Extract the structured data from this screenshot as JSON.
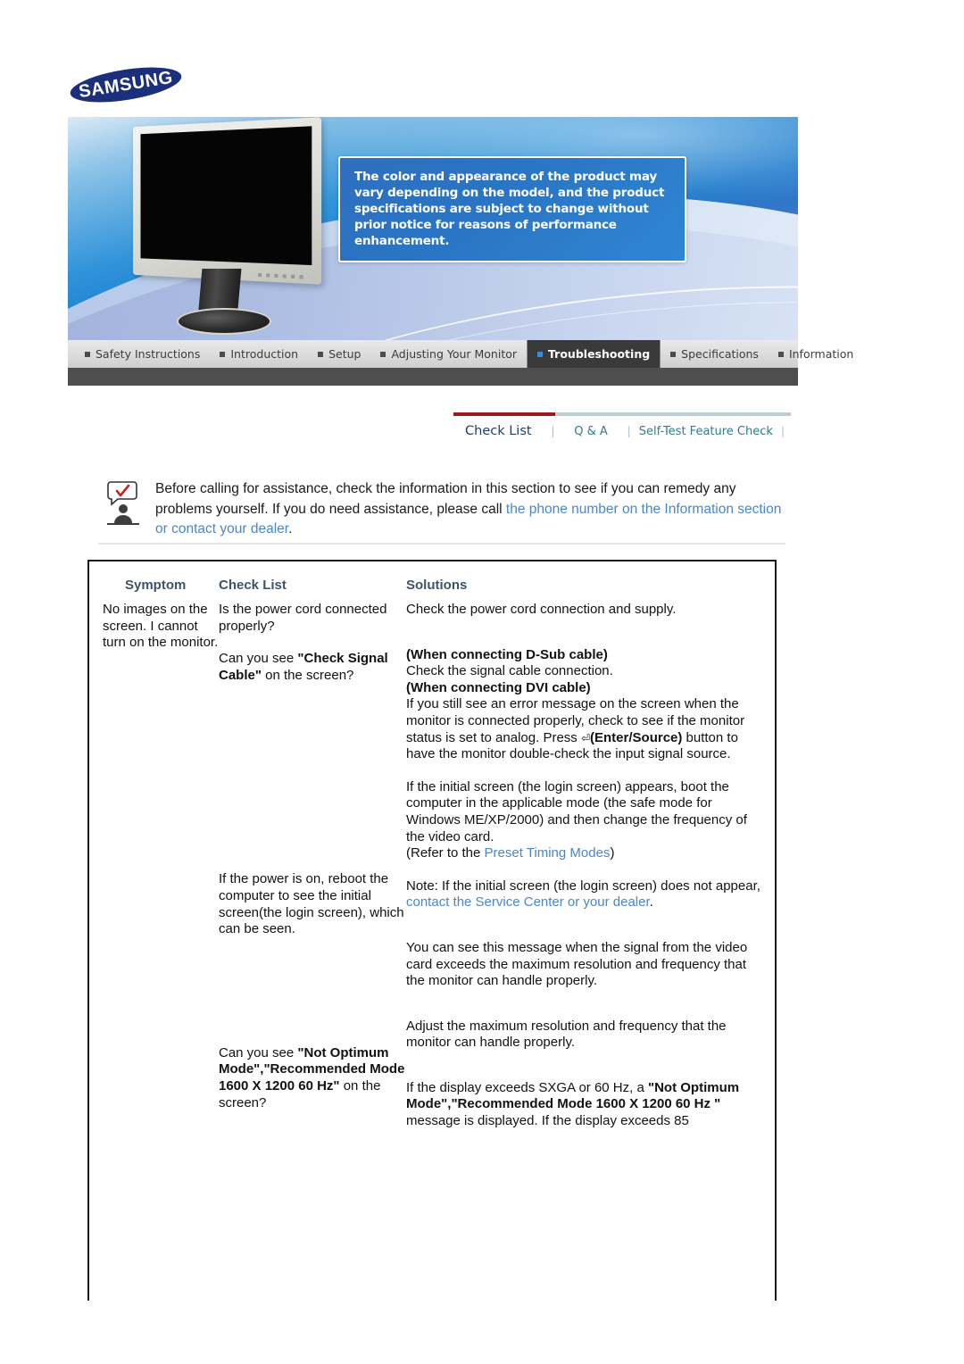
{
  "brand": {
    "logo_text": "SAMSUNG"
  },
  "banner": {
    "disclaimer": "The color and appearance of the product may vary depending on the model, and the product specifications are subject to change without prior notice for reasons of performance enhancement.",
    "product_image_alt": "silver-lcd-monitor"
  },
  "nav": {
    "items": [
      {
        "label": "Safety Instructions",
        "active": false
      },
      {
        "label": "Introduction",
        "active": false
      },
      {
        "label": "Setup",
        "active": false
      },
      {
        "label": "Adjusting Your Monitor",
        "active": false
      },
      {
        "label": "Troubleshooting",
        "active": true
      },
      {
        "label": "Specifications",
        "active": false
      },
      {
        "label": "Information",
        "active": false
      }
    ],
    "active_accent": "#2f8fe0",
    "active_bg": "#3a3a3a"
  },
  "subnav": {
    "items": [
      {
        "label": "Check List",
        "active": true
      },
      {
        "label": "Q & A",
        "active": false
      },
      {
        "label": "Self-Test Feature Check",
        "active": false
      }
    ],
    "separator": "|",
    "accent_red": "#9e1b1b",
    "accent_teal": "#2f7d8c"
  },
  "intro": {
    "icon": "person-with-checkmark-speech-bubble-icon",
    "text_part1": "Before calling for assistance, check the information in this section to see if you can remedy any problems yourself. If you do need assistance, please call ",
    "link_text": "the phone number on the Information section or contact your dealer",
    "text_part2": "."
  },
  "table": {
    "headers": {
      "symptom": "Symptom",
      "check_list": "Check List",
      "solutions": "Solutions"
    },
    "symptom": "No images on the screen. I cannot turn on the monitor.",
    "checklist": {
      "row1": "Is the power cord connected properly?",
      "row2_pre": "Can you see ",
      "row2_bold": "\"Check Signal Cable\"",
      "row2_post": " on the screen?",
      "row3": "If the power is on, reboot the computer to see the initial screen(the login screen), which can be seen.",
      "row4_pre": "Can you see ",
      "row4_bold": "\"Not Optimum Mode\",\"Recommended Mode 1600 X 1200 60 Hz\"",
      "row4_post": " on the screen?"
    },
    "solutions": {
      "row1": "Check the power cord connection and supply.",
      "row2_h1": "(When connecting D-Sub cable)",
      "row2_t1": "Check the signal cable connection.",
      "row2_h2": "(When connecting DVI cable)",
      "row2_t2": "If you still see an error message on the screen when the monitor is connected properly, check to see if the monitor status is set to analog.",
      "row2_press_pre": "Press ",
      "row2_press_key": "⏎",
      "row2_press_bold": "(Enter/Source)",
      "row2_press_post": " button to have the monitor double-check the input signal source.",
      "row3_a": "If the initial screen (the login screen) appears, boot the computer in the applicable mode (the safe mode for Windows ME/XP/2000) and then change the frequency of the video card.",
      "row3_refer_pre": "(Refer to the ",
      "row3_refer_link": "Preset Timing Modes",
      "row3_refer_post": ")",
      "row3_note_pre": "Note: If the initial screen (the login screen) does not appear, ",
      "row3_note_link": "contact the Service Center or your dealer",
      "row3_note_post": ".",
      "row4_a": "You can see this message when the signal from the video card exceeds the maximum resolution and frequency that the monitor can handle properly.",
      "row4_b": "Adjust the maximum resolution and frequency that the monitor can handle properly.",
      "row4_c_pre": "If the display exceeds SXGA or 60 Hz, a ",
      "row4_c_bold": "\"Not Optimum Mode\",\"Recommended Mode 1600 X 1200 60 Hz \"",
      "row4_c_post": " message is displayed. If the display exceeds 85"
    }
  }
}
